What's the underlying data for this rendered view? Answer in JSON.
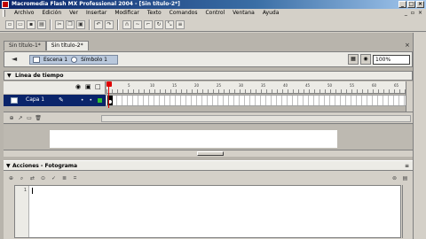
{
  "window": {
    "title": "Macromedia Flash MX Professional 2004 - [Sin título-2*]",
    "minimize": "_",
    "maximize": "□",
    "close": "×"
  },
  "menubar": {
    "items": [
      "Archivo",
      "Edición",
      "Ver",
      "Insertar",
      "Modificar",
      "Texto",
      "Comandos",
      "Control",
      "Ventana",
      "Ayuda"
    ],
    "right_minimize": "_",
    "right_restore": "▫",
    "right_close": "×"
  },
  "toolbar": {
    "icons": [
      "new-doc",
      "open",
      "save",
      "print",
      "cut",
      "copy",
      "paste",
      "undo",
      "redo",
      "snap",
      "smooth",
      "straighten",
      "rotate",
      "scale",
      "align"
    ]
  },
  "document_tabs": {
    "tabs": [
      "Sin título-1*",
      "Sin título-2*"
    ],
    "active_index": 1,
    "close": "×"
  },
  "scene_bar": {
    "back": "◄",
    "scene_label": "Escena 1",
    "symbol_label": "Símbolo 1",
    "zoom_value": "100%"
  },
  "timeline": {
    "header": "Línea de tiempo",
    "collapse": "▼",
    "column_icons": [
      "eye",
      "lock",
      "outline"
    ],
    "ruler_numbers": [
      "5",
      "10",
      "15",
      "20",
      "25",
      "30",
      "35",
      "40",
      "45",
      "50",
      "55",
      "60",
      "65"
    ],
    "layer": {
      "name": "Capa 1",
      "pencil": "✎",
      "visible_dot": "•",
      "lock_dot": "•"
    },
    "bottom_icons": [
      "add-layer",
      "add-guide",
      "insert-folder",
      "delete-layer"
    ]
  },
  "actions_panel": {
    "header": "Acciones - Fotograma",
    "collapse": "▼",
    "close": "≡",
    "line_numbers": [
      "1"
    ],
    "toolbar_icons": [
      "add",
      "find",
      "replace",
      "target",
      "check-syntax",
      "auto-format",
      "hint"
    ],
    "right_icons": [
      "reference",
      "options"
    ]
  },
  "colors": {
    "title_active": "#0a246a",
    "chrome": "#d4d0c8",
    "playhead": "#e00000",
    "layer_selected": "#0a246a"
  }
}
